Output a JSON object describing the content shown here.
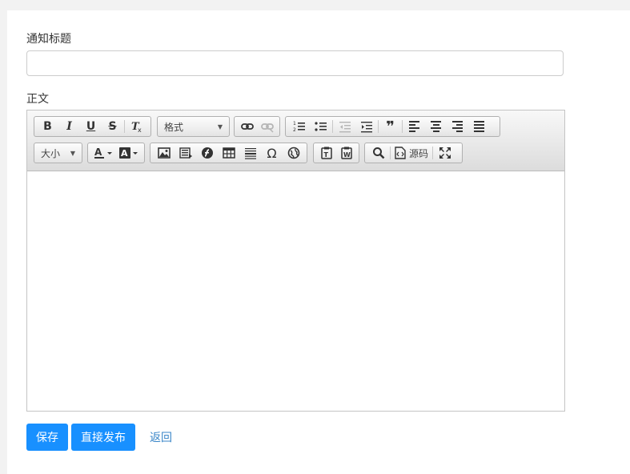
{
  "form": {
    "title_label": "通知标题",
    "title_value": "",
    "body_label": "正文"
  },
  "editor": {
    "format_combo": "格式",
    "size_combo": "大小",
    "source_label": "源码",
    "content": ""
  },
  "actions": {
    "save": "保存",
    "publish": "直接发布",
    "back": "返回"
  },
  "colors": {
    "primary": "#1890ff",
    "link": "#3a86c8"
  }
}
